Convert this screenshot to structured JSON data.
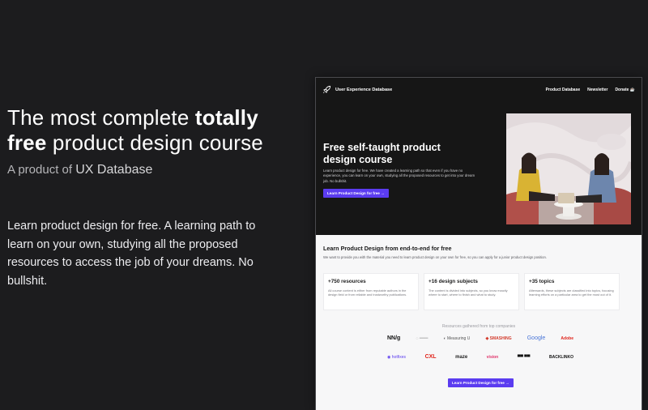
{
  "hero": {
    "headline_part1": "The most complete ",
    "headline_bold1": "totally",
    "headline_bold2": "free",
    "headline_part2": " product design course",
    "byline_prefix": "A product of ",
    "byline_brand": "UX Database",
    "description": "Learn product design for free. A learning path to learn on your own, studying all the proposed resources to access the job of your dreams. No bullshit."
  },
  "preview": {
    "nav": {
      "logo_text": "User Experience Database",
      "links": [
        "Product Database",
        "Newsletter",
        "Donate ☕"
      ]
    },
    "title": "Free self-taught product design course",
    "subtitle": "Learn product design for free. We have created a learning path so that even if you have no experience, you can learn on your own, studying all the proposed resources to get into your dream job. No bullshit.",
    "cta_label": "Learn Product Design for free →",
    "section": {
      "title": "Learn Product Design from end-to-end for free",
      "subtitle": "We want to provide you with the material you need to learn product design on your own for free, so you can apply for a junior product design position.",
      "cards": [
        {
          "title": "+750 resources",
          "text": "All course content is either from reputable authors in the design field or from reliable and trustworthy publications."
        },
        {
          "title": "+16 design subjects",
          "text": "The content is divided into subjects, so you know exactly where to start, where to finish and what to study."
        },
        {
          "title": "+35 topics",
          "text": "Afterwards, these subjects are classified into topics, focusing learning efforts on a particular area to get the most out of it."
        }
      ],
      "logos_title": "Resources gathered from top companies",
      "logos_row1": [
        "NN/g",
        "◌ ═══",
        "◐ Measuring U",
        "◆ SMASHING",
        "Google",
        "Adobe"
      ],
      "logos_row2": [
        "◉ hotfixes",
        "CXL",
        "maze",
        "vision",
        "▀▀ ▀▀",
        "BACKLINKO"
      ],
      "cta_label": "Learn Product Design for free →"
    }
  },
  "colors": {
    "page_bg": "#1c1c1e",
    "accent": "#5b3cf0",
    "hero_dark": "#161616"
  }
}
